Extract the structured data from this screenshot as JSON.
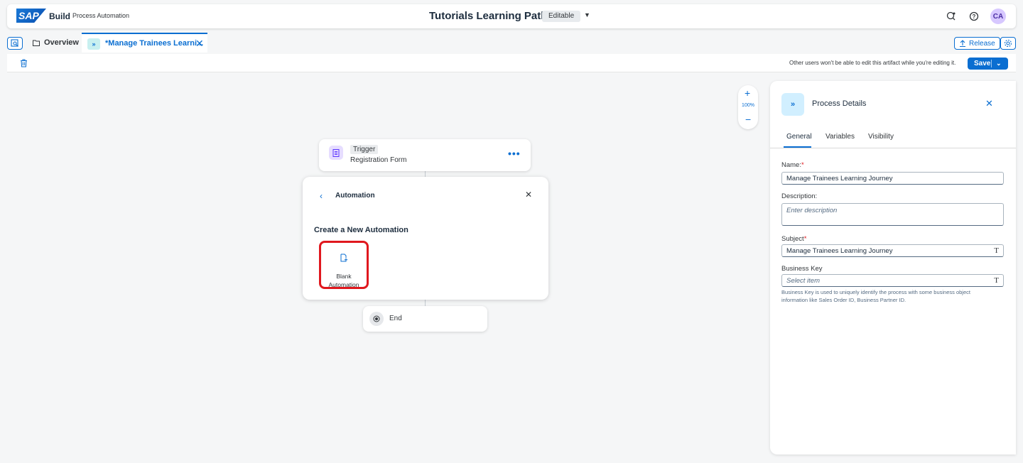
{
  "shell": {
    "logo_text": "SAP",
    "brand": "Build",
    "product": "Process Automation",
    "title": "Tutorials Learning Path",
    "status": "Editable",
    "avatar": "CA"
  },
  "tabs": {
    "overview": "Overview",
    "active": "*Manage Trainees Learni...",
    "release": "Release"
  },
  "toolbar": {
    "warning": "Other users won't be able to edit this artifact while you're editing it.",
    "save": "Save"
  },
  "zoom": {
    "level": "100%"
  },
  "trigger": {
    "tag": "Trigger",
    "name": "Registration Form"
  },
  "automation_panel": {
    "title": "Automation",
    "heading": "Create a New Automation",
    "blank_line1": "Blank",
    "blank_line2": "Automation"
  },
  "end_node": {
    "label": "End"
  },
  "details": {
    "title": "Process Details",
    "tabs": [
      "General",
      "Variables",
      "Visibility"
    ],
    "name_label": "Name:",
    "name_value": "Manage Trainees Learning Journey",
    "description_label": "Description:",
    "description_placeholder": "Enter description",
    "subject_label": "Subject",
    "subject_value": "Manage Trainees Learning Journey",
    "business_key_label": "Business Key",
    "business_key_placeholder": "Select item",
    "business_key_help": "Business Key is used to uniquely identify the process with some business object information like Sales Order ID, Business Partner ID."
  },
  "colors": {
    "accent": "#0a6ed1",
    "highlight": "#e0181e"
  }
}
